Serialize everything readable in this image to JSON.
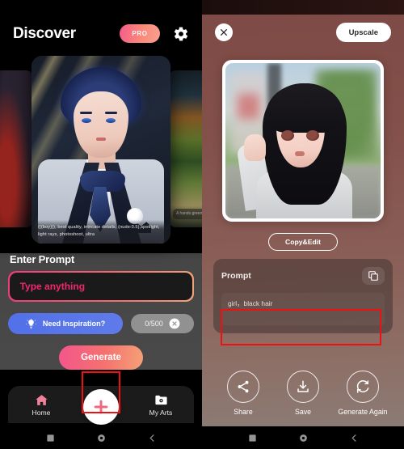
{
  "left": {
    "header": {
      "title": "Discover",
      "pro_badge": "PRO",
      "gear_icon": "gear-icon"
    },
    "carousel": {
      "main_caption": "(((boy))), best quality, intricate details, (nude:0.5),spotlight, light rays, photoshoot, ultra",
      "right_card_caption": "A hands greenfi"
    },
    "prompt_section": {
      "label": "Enter Prompt",
      "input_placeholder": "Type anything",
      "inspire_label": "Need Inspiration?",
      "inspire_icon": "lightbulb-icon",
      "counter": "0/500",
      "clear_icon": "clear-icon",
      "generate_label": "Generate"
    },
    "tabbar": {
      "items": [
        {
          "label": "Home",
          "icon": "home-icon"
        },
        {
          "label": "My Arts",
          "icon": "folder-icon"
        }
      ],
      "fab_icon": "plus-icon"
    },
    "navbar": {
      "recents_icon": "square-icon",
      "home_icon": "circle-icon",
      "back_icon": "chevron-left-icon"
    }
  },
  "right": {
    "header": {
      "close_icon": "close-icon",
      "upscale_label": "Upscale"
    },
    "copy_edit_label": "Copy&Edit",
    "prompt_card": {
      "title": "Prompt",
      "copy_icon": "copy-icon",
      "value": "girl，black hair"
    },
    "actions": [
      {
        "label": "Share",
        "icon": "share-icon"
      },
      {
        "label": "Save",
        "icon": "download-icon"
      },
      {
        "label": "Generate Again",
        "icon": "refresh-icon"
      }
    ],
    "navbar": {
      "recents_icon": "square-icon",
      "home_icon": "circle-icon",
      "back_icon": "chevron-left-icon"
    }
  },
  "annotations": {
    "fab_highlight_color": "#ee1111",
    "prompt_highlight_color": "#ee1111"
  }
}
